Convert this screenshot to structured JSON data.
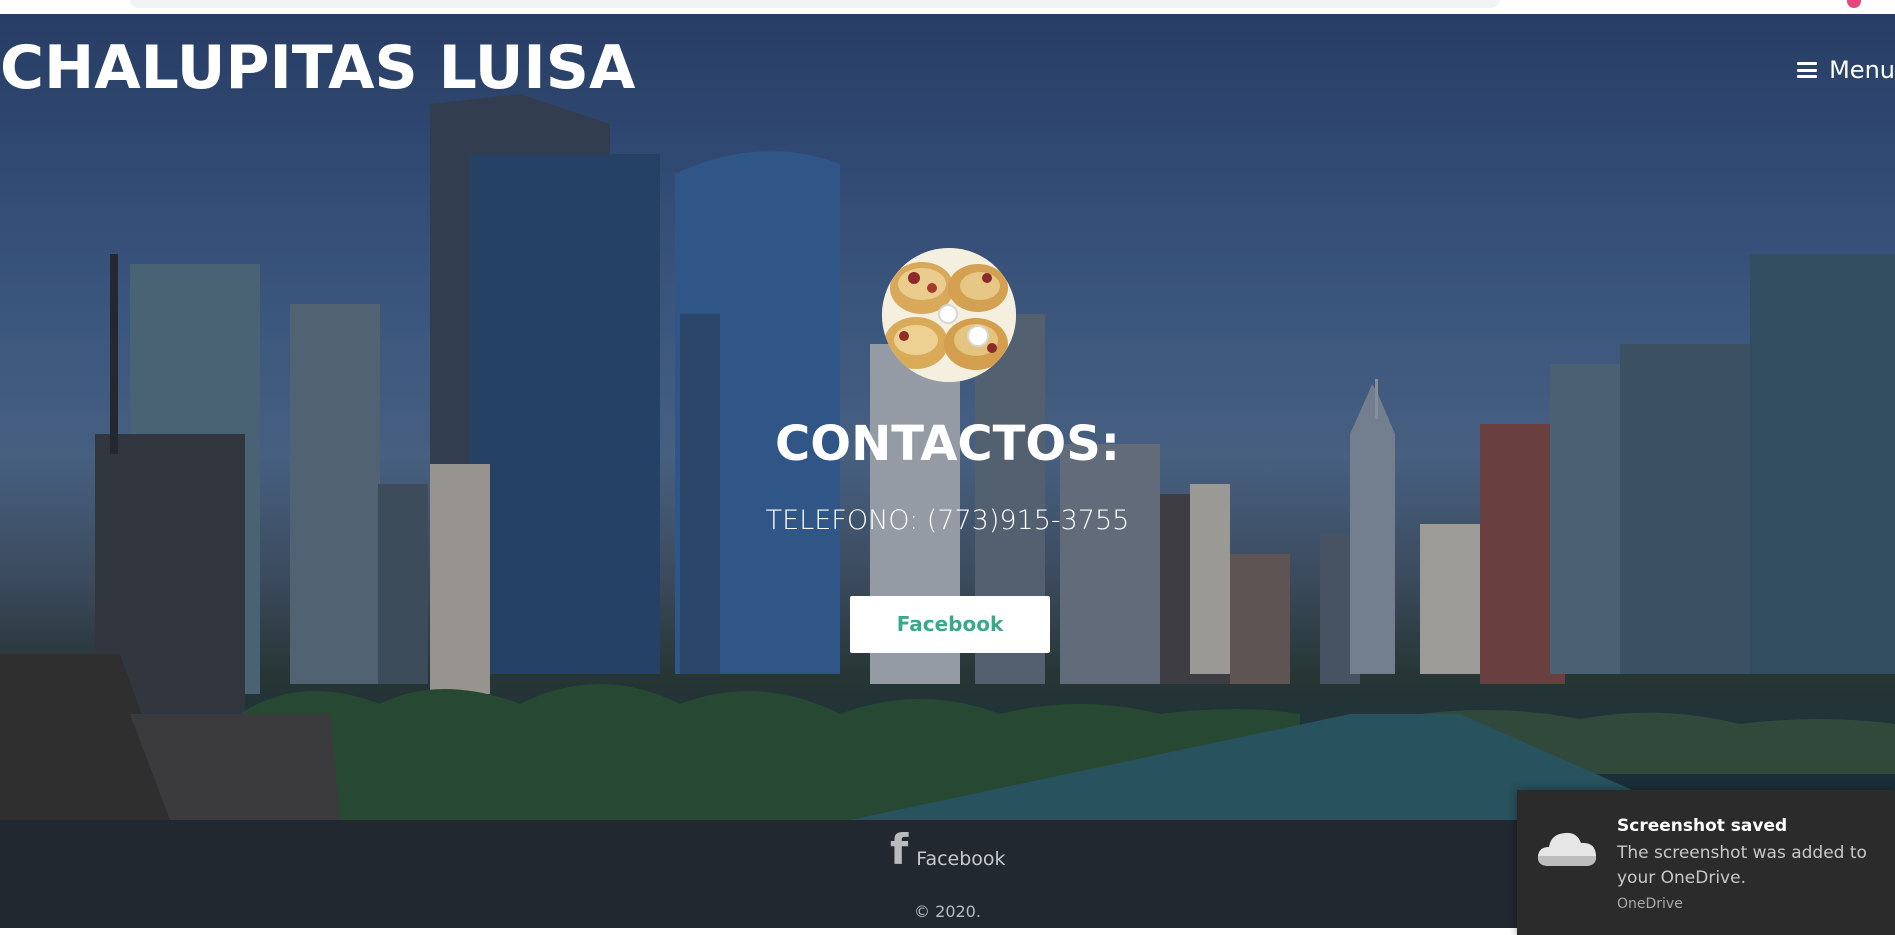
{
  "site": {
    "brand": "CHALUPITAS LUISA",
    "menu_label": "Menu",
    "menu_icon": "hamburger-icon"
  },
  "contact": {
    "title": "CONTACTOS:",
    "phone": "TELEFONO: (773)915-3755",
    "facebook_button": "Facebook"
  },
  "footer": {
    "facebook_link": "Facebook",
    "facebook_icon": "facebook-f-icon",
    "copyright": "© 2020."
  },
  "toast": {
    "title": "Screenshot saved",
    "body": "The screenshot was added to your OneDrive.",
    "source": "OneDrive",
    "icon": "onedrive-cloud-icon"
  },
  "colors": {
    "button_text": "#3aa989",
    "footer_bg": "#212830",
    "toast_bg": "#2b2b2b"
  }
}
